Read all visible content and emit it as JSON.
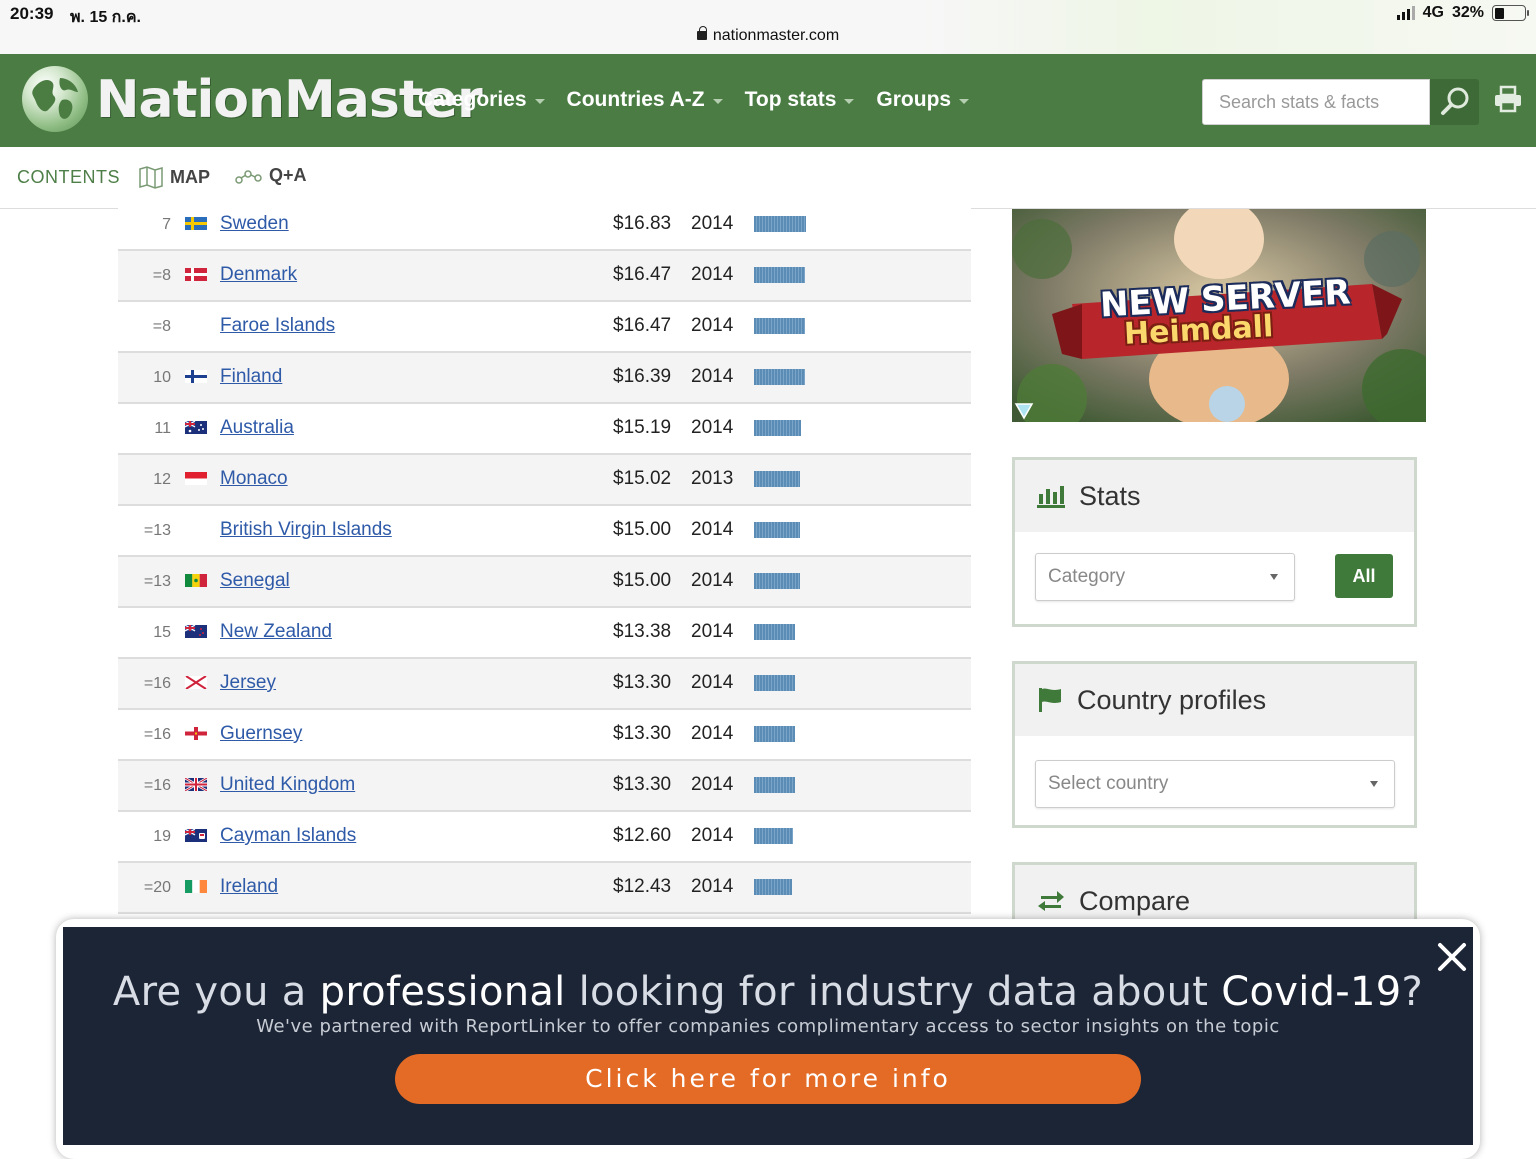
{
  "status": {
    "time": "20:39",
    "date": "พ. 15 ก.ค.",
    "network": "4G",
    "battery": "32%"
  },
  "browser": {
    "url": "nationmaster.com"
  },
  "header": {
    "logo": "NationMaster",
    "nav": [
      "Categories",
      "Countries A-Z",
      "Top stats",
      "Groups"
    ],
    "search_placeholder": "Search stats & facts"
  },
  "subnav": {
    "contents": "CONTENTS",
    "map": "MAP",
    "qa": "Q+A"
  },
  "table": {
    "rows": [
      {
        "rank": "7",
        "flag": "sweden",
        "country": "Sweden",
        "value": "$16.83",
        "year": "2014",
        "bar_pct": 100
      },
      {
        "rank": "=8",
        "flag": "denmark",
        "country": "Denmark",
        "value": "$16.47",
        "year": "2014",
        "bar_pct": 97.9
      },
      {
        "rank": "=8",
        "flag": "none",
        "country": "Faroe Islands",
        "value": "$16.47",
        "year": "2014",
        "bar_pct": 97.9
      },
      {
        "rank": "10",
        "flag": "finland",
        "country": "Finland",
        "value": "$16.39",
        "year": "2014",
        "bar_pct": 97.4
      },
      {
        "rank": "11",
        "flag": "australia",
        "country": "Australia",
        "value": "$15.19",
        "year": "2014",
        "bar_pct": 90.3
      },
      {
        "rank": "12",
        "flag": "monaco",
        "country": "Monaco",
        "value": "$15.02",
        "year": "2013",
        "bar_pct": 89.2
      },
      {
        "rank": "=13",
        "flag": "none",
        "country": "British Virgin Islands",
        "value": "$15.00",
        "year": "2014",
        "bar_pct": 89.1
      },
      {
        "rank": "=13",
        "flag": "senegal",
        "country": "Senegal",
        "value": "$15.00",
        "year": "2014",
        "bar_pct": 89.1
      },
      {
        "rank": "15",
        "flag": "newzealand",
        "country": "New Zealand",
        "value": "$13.38",
        "year": "2014",
        "bar_pct": 79.5
      },
      {
        "rank": "=16",
        "flag": "jersey",
        "country": "Jersey",
        "value": "$13.30",
        "year": "2014",
        "bar_pct": 79.0
      },
      {
        "rank": "=16",
        "flag": "guernsey",
        "country": "Guernsey",
        "value": "$13.30",
        "year": "2014",
        "bar_pct": 79.0
      },
      {
        "rank": "=16",
        "flag": "uk",
        "country": "United Kingdom",
        "value": "$13.30",
        "year": "2014",
        "bar_pct": 79.0
      },
      {
        "rank": "19",
        "flag": "cayman",
        "country": "Cayman Islands",
        "value": "$12.60",
        "year": "2014",
        "bar_pct": 74.9
      },
      {
        "rank": "=20",
        "flag": "ireland",
        "country": "Ireland",
        "value": "$12.43",
        "year": "2014",
        "bar_pct": 73.9
      }
    ]
  },
  "ad": {
    "line1": "NEW SERVER",
    "line2": "Heimdall"
  },
  "widgets": {
    "stats": {
      "title": "Stats",
      "select": "Category",
      "button": "All"
    },
    "profiles": {
      "title": "Country profiles",
      "select": "Select country"
    },
    "compare": {
      "title": "Compare"
    }
  },
  "banner": {
    "title_1": "Are you a ",
    "title_bold_1": "professional",
    "title_2": " looking for industry data about ",
    "title_bold_2": "Covid-19",
    "title_3": "?",
    "subtitle": "We've partnered with ReportLinker to offer companies complimentary access to sector insights on the topic",
    "button": "Click here for more info"
  },
  "colors": {
    "header": "#4a7c43",
    "link": "#2e5aa8",
    "bar": "#5a8cb5",
    "banner_bg": "#1c2536",
    "banner_btn": "#e46b25"
  }
}
